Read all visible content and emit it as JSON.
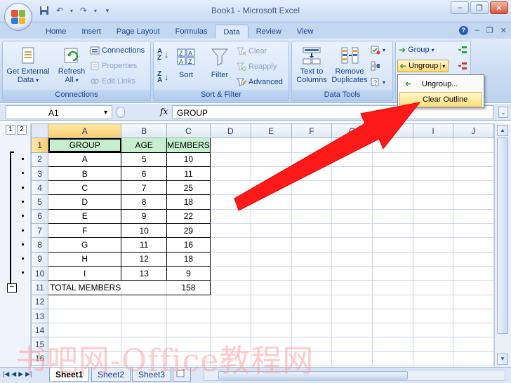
{
  "app": {
    "title": "Book1 - Microsoft Excel"
  },
  "window_controls": {
    "minimize": "–",
    "restore": "❐",
    "close": "✕"
  },
  "tabs": [
    {
      "label": "Home"
    },
    {
      "label": "Insert"
    },
    {
      "label": "Page Layout"
    },
    {
      "label": "Formulas"
    },
    {
      "label": "Data",
      "active": true
    },
    {
      "label": "Review"
    },
    {
      "label": "View"
    }
  ],
  "ribbon": {
    "connections_group": {
      "label": "Connections",
      "get_external_line1": "Get External",
      "get_external_line2": "Data",
      "refresh_line1": "Refresh",
      "refresh_line2": "All",
      "connections": "Connections",
      "properties": "Properties",
      "edit_links": "Edit Links"
    },
    "sort_filter_group": {
      "label": "Sort & Filter",
      "sort": "Sort",
      "filter": "Filter",
      "clear": "Clear",
      "reapply": "Reapply",
      "advanced": "Advanced"
    },
    "data_tools_group": {
      "label": "Data Tools",
      "text_to_columns_line1": "Text to",
      "text_to_columns_line2": "Columns",
      "remove_duplicates_line1": "Remove",
      "remove_duplicates_line2": "Duplicates"
    },
    "outline_group": {
      "group": "Group",
      "ungroup": "Ungroup"
    }
  },
  "ungroup_menu": {
    "items": [
      "Ungroup...",
      "Clear Outline"
    ]
  },
  "formula_bar": {
    "name_box": "A1",
    "fx": "fx",
    "formula": "GROUP"
  },
  "outline": {
    "levels": [
      "1",
      "2"
    ]
  },
  "sheet": {
    "columns": [
      "A",
      "B",
      "C",
      "D",
      "E",
      "F",
      "G",
      "H",
      "I",
      "J"
    ],
    "row_numbers": [
      "1",
      "2",
      "3",
      "4",
      "5",
      "6",
      "7",
      "8",
      "9",
      "10",
      "11",
      "12",
      "13",
      "14",
      "15",
      "16"
    ],
    "header": [
      "GROUP",
      "AGE",
      "MEMBERS"
    ],
    "rows": [
      [
        "A",
        "5",
        "10"
      ],
      [
        "B",
        "6",
        "11"
      ],
      [
        "C",
        "7",
        "25"
      ],
      [
        "D",
        "8",
        "18"
      ],
      [
        "E",
        "9",
        "22"
      ],
      [
        "F",
        "10",
        "29"
      ],
      [
        "G",
        "11",
        "16"
      ],
      [
        "H",
        "12",
        "18"
      ],
      [
        "I",
        "13",
        "9"
      ]
    ],
    "total_label": "TOTAL MEMBERS",
    "total_value": "158"
  },
  "sheet_tabs": [
    "Sheet1",
    "Sheet2",
    "Sheet3"
  ],
  "watermark": "书吧网-Office教程网",
  "colors": {
    "header_fill": "#c6efce",
    "annotation_arrow": "#ff1a1a",
    "menu_highlight": "#ffde7a"
  }
}
